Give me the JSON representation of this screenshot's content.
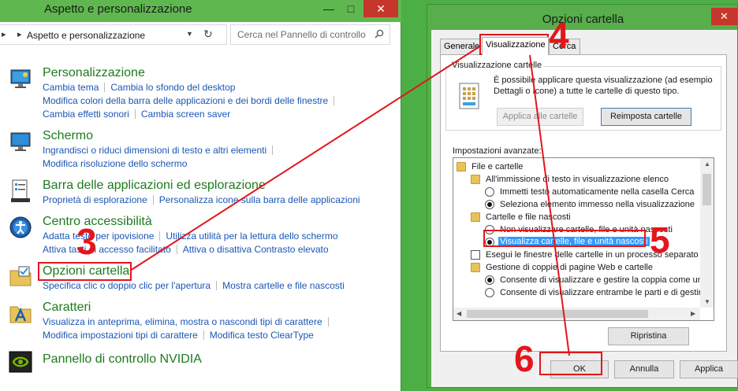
{
  "control_panel": {
    "title": "Aspetto e personalizzazione",
    "window_buttons": {
      "minimize": "—",
      "maximize": "□",
      "close": "✕"
    },
    "breadcrumb": "Aspetto e personalizzazione",
    "search_placeholder": "Cerca nel Pannello di controllo",
    "categories": [
      {
        "title": "Personalizzazione",
        "icon": "personalization-icon",
        "rows": [
          [
            "Cambia tema",
            "Cambia lo sfondo del desktop"
          ],
          [
            "Modifica colori della barra delle applicazioni e dei bordi delle finestre"
          ],
          [
            "Cambia effetti sonori",
            "Cambia screen saver"
          ]
        ]
      },
      {
        "title": "Schermo",
        "icon": "display-icon",
        "rows": [
          [
            "Ingrandisci o riduci dimensioni di testo e altri elementi"
          ],
          [
            "Modifica risoluzione dello schermo"
          ]
        ]
      },
      {
        "title": "Barra delle applicazioni ed esplorazione",
        "icon": "taskbar-icon",
        "rows": [
          [
            "Proprietà di esplorazione",
            "Personalizza icone sulla barra delle applicazioni"
          ]
        ]
      },
      {
        "title": "Centro accessibilità",
        "icon": "accessibility-icon",
        "rows": [
          [
            "Adatta testo per ipovisione",
            "Utilizza utilità per la lettura dello schermo"
          ],
          [
            "Attiva tasti di accesso facilitato",
            "Attiva o disattiva Contrasto elevato"
          ]
        ]
      },
      {
        "title": "Opzioni cartella",
        "icon": "folder-options-icon",
        "rows": [
          [
            "Specifica clic o doppio clic per l'apertura",
            "Mostra cartelle e file nascosti"
          ]
        ]
      },
      {
        "title": "Caratteri",
        "icon": "fonts-icon",
        "rows": [
          [
            "Visualizza in anteprima, elimina, mostra o nascondi tipi di carattere"
          ],
          [
            "Modifica impostazioni tipi di carattere",
            "Modifica testo ClearType"
          ]
        ]
      },
      {
        "title": "Pannello di controllo NVIDIA",
        "icon": "nvidia-icon",
        "rows": []
      }
    ]
  },
  "dialog": {
    "title": "Opzioni cartella",
    "close": "✕",
    "tabs": {
      "general": "Generale",
      "view": "Visualizzazione",
      "search": "Cerca"
    },
    "folder_views": {
      "label": "Visualizzazione cartelle",
      "description": "È possibile applicare questa visualizzazione (ad esempio Dettagli o Icone) a tutte le cartelle di questo tipo.",
      "apply_all": "Applica alle cartelle",
      "reset": "Reimposta cartelle"
    },
    "advanced_label": "Impostazioni avanzate:",
    "tree": [
      {
        "type": "folder",
        "indent": 0,
        "label": "File e cartelle"
      },
      {
        "type": "folder",
        "indent": 1,
        "label": "All'immissione di testo in visualizzazione elenco"
      },
      {
        "type": "radio",
        "indent": 2,
        "checked": false,
        "label": "Immetti testo automaticamente nella casella Cerca"
      },
      {
        "type": "radio",
        "indent": 2,
        "checked": true,
        "label": "Seleziona elemento immesso nella visualizzazione"
      },
      {
        "type": "folder",
        "indent": 1,
        "label": "Cartelle e file nascosti"
      },
      {
        "type": "radio",
        "indent": 2,
        "checked": false,
        "label": "Non visualizzare cartelle, file e unità nascosti"
      },
      {
        "type": "radio",
        "indent": 2,
        "checked": true,
        "label": "Visualizza cartelle, file e unità nascosti",
        "selected": true
      },
      {
        "type": "check",
        "indent": 1,
        "checked": false,
        "label": "Esegui le finestre delle cartelle in un processo separato"
      },
      {
        "type": "folder",
        "indent": 1,
        "label": "Gestione di coppie di pagine Web e cartelle"
      },
      {
        "type": "radio",
        "indent": 2,
        "checked": true,
        "label": "Consente di visualizzare e gestire la coppia come un s"
      },
      {
        "type": "radio",
        "indent": 2,
        "checked": false,
        "label": "Consente di visualizzare entrambe le parti e di gestirle"
      }
    ],
    "restore": "Ripristina",
    "ok": "OK",
    "cancel": "Annulla",
    "apply": "Applica"
  },
  "annotations": {
    "step3": "3",
    "step4": "4",
    "step5": "5",
    "step6": "6",
    "color": "#e3161c"
  }
}
